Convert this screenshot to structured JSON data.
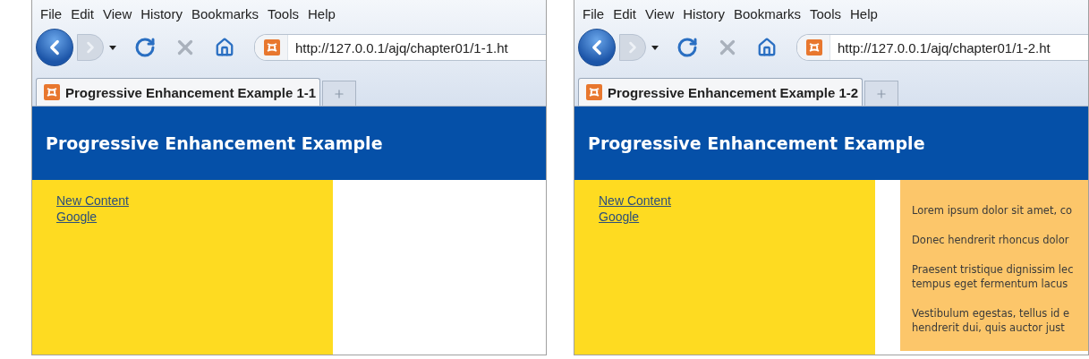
{
  "windows": [
    {
      "menu": [
        "File",
        "Edit",
        "View",
        "History",
        "Bookmarks",
        "Tools",
        "Help"
      ],
      "url": "http://127.0.0.1/ajq/chapter01/1-1.ht",
      "tabs": [
        {
          "label": "Progressive Enhancement Example 1-1",
          "selected": true
        }
      ],
      "page": {
        "header": "Progressive Enhancement Example",
        "links": [
          "New Content",
          "Google"
        ]
      }
    },
    {
      "menu": [
        "File",
        "Edit",
        "View",
        "History",
        "Bookmarks",
        "Tools",
        "Help"
      ],
      "url": "http://127.0.0.1/ajq/chapter01/1-2.ht",
      "tabs": [
        {
          "label": "Progressive Enhancement Example 1-2",
          "selected": true
        }
      ],
      "page": {
        "header": "Progressive Enhancement Example",
        "links": [
          "New Content",
          "Google"
        ],
        "paragraphs": [
          {
            "lines": [
              "Lorem ipsum dolor sit amet, co"
            ]
          },
          {
            "lines": [
              "Donec hendrerit rhoncus dolor"
            ]
          },
          {
            "lines": [
              "Praesent tristique dignissim lec",
              "tempus eget fermentum lacus"
            ]
          },
          {
            "lines": [
              "Vestibulum egestas, tellus id e",
              "hendrerit dui, quis auctor just"
            ]
          }
        ]
      }
    }
  ]
}
